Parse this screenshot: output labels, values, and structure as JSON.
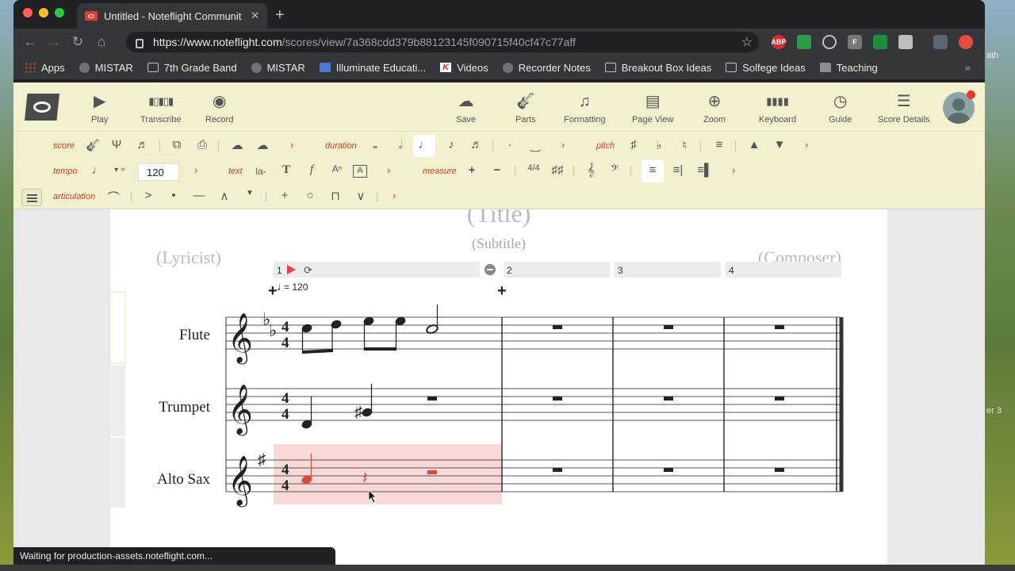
{
  "browser": {
    "tab_title": "Untitled - Noteflight Communit",
    "url_host": "https://www.noteflight.com",
    "url_path": "/scores/view/7a368cdd379b88123145f090715f40cf47c77aff",
    "extensions": [
      "ABP",
      "F"
    ],
    "bookmarks": [
      {
        "label": "Apps",
        "icon": "apps-grid"
      },
      {
        "label": "MISTAR",
        "icon": "globe"
      },
      {
        "label": "7th Grade Band",
        "icon": "folder"
      },
      {
        "label": "MISTAR",
        "icon": "globe"
      },
      {
        "label": "Illuminate Educati...",
        "icon": "illuminate"
      },
      {
        "label": "Videos",
        "icon": "k-logo"
      },
      {
        "label": "Recorder Notes",
        "icon": "globe"
      },
      {
        "label": "Breakout Box Ideas",
        "icon": "folder"
      },
      {
        "label": "Solfege Ideas",
        "icon": "folder"
      },
      {
        "label": "Teaching",
        "icon": "teaching"
      }
    ]
  },
  "toolbar": {
    "play": "Play",
    "transcribe": "Transcribe",
    "record": "Record",
    "save": "Save",
    "parts": "Parts",
    "formatting": "Formatting",
    "page_view": "Page View",
    "zoom": "Zoom",
    "keyboard": "Keyboard",
    "guide": "Guide",
    "score_details": "Score Details"
  },
  "palette": {
    "score": "score",
    "duration": "duration",
    "pitch": "pitch",
    "tempo": "tempo",
    "tempo_value": "120",
    "text": "text",
    "text_la": "la-",
    "measure": "measure",
    "articulation": "articulation"
  },
  "score": {
    "title": "(Title)",
    "subtitle": "(Subtitle)",
    "lyricist": "(Lyricist)",
    "composer": "(Composer)",
    "tempo_mark": "= 120",
    "measure_numbers": [
      "1",
      "2",
      "3",
      "4"
    ],
    "instruments": [
      "Flute",
      "Trumpet",
      "Alto Sax"
    ],
    "time_sig_top": "4",
    "time_sig_bottom": "4",
    "highlight_color": "#f8d9d6",
    "selection_color": "#e0463a"
  },
  "status": "Waiting for production-assets.noteflight.com...",
  "desktop": {
    "side_text_1": "ath",
    "side_text_2": "er 3"
  }
}
